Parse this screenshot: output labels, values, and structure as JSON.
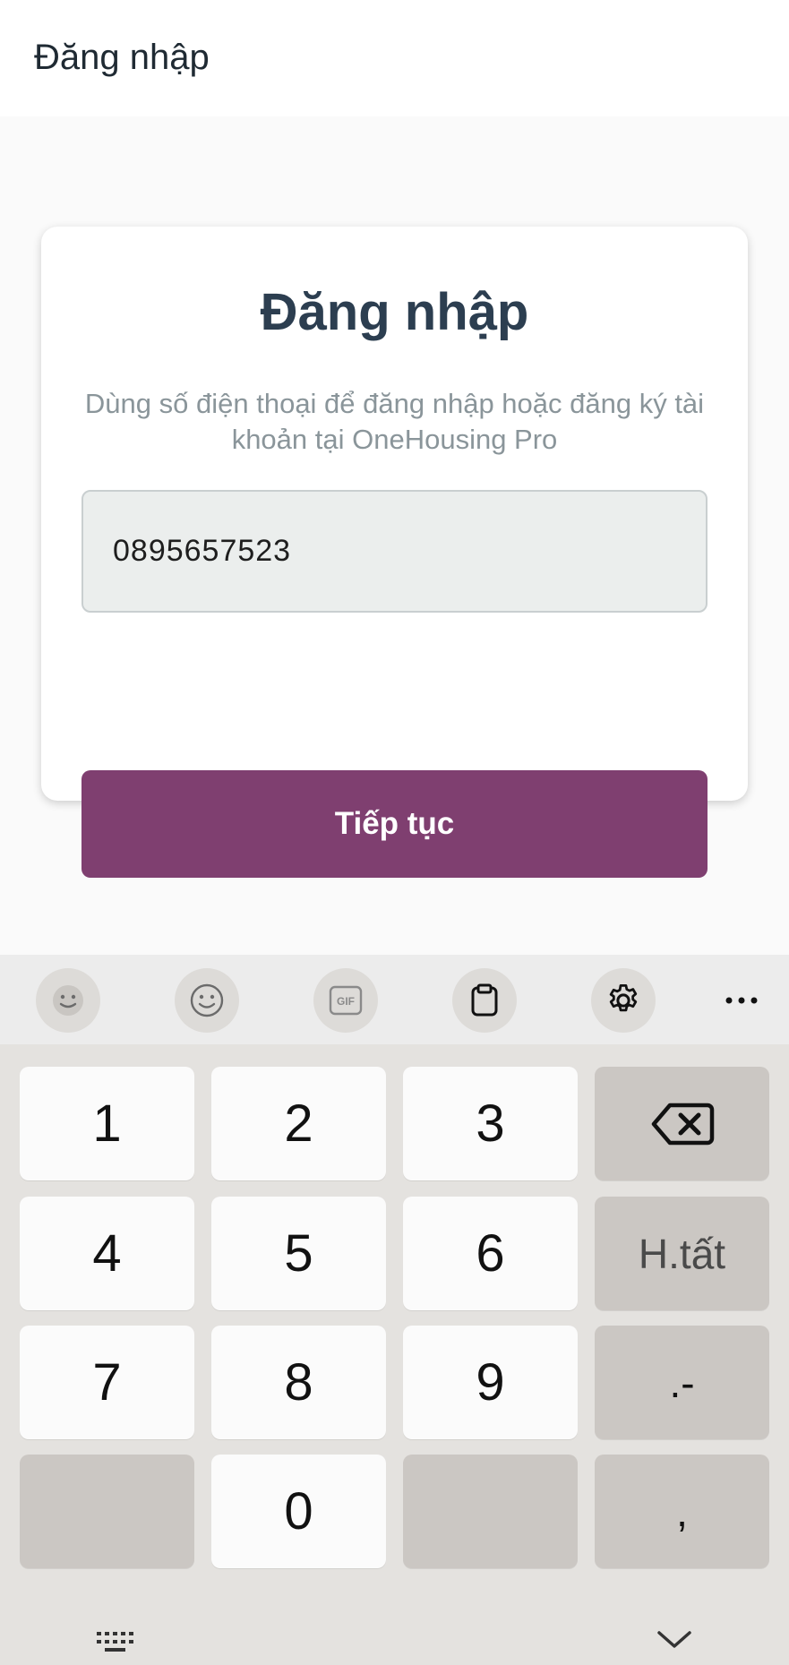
{
  "header": {
    "title": "Đăng nhập"
  },
  "card": {
    "title": "Đăng nhập",
    "subtitle": "Dùng số điện thoại để đăng nhập hoặc đăng ký tài khoản tại OneHousing Pro",
    "phone_value": "0895657523",
    "continue_label": "Tiếp tục"
  },
  "colors": {
    "accent": "#7f3f70",
    "title": "#2c3e50",
    "subtitle": "#8a959a"
  },
  "keyboard": {
    "toolbar_icons": [
      "emoji-face-icon",
      "smiley-icon",
      "gif-icon",
      "clipboard-icon",
      "settings-icon",
      "more-icon"
    ],
    "gif_label": "GIF",
    "keys": {
      "k1": "1",
      "k2": "2",
      "k3": "3",
      "k4": "4",
      "k5": "5",
      "k6": "6",
      "k7": "7",
      "k8": "8",
      "k9": "9",
      "k0": "0",
      "done": "H.tất",
      "dot_dash": ".-",
      "comma": ","
    },
    "bottom_icons": [
      "keyboard-switch-icon",
      "hide-keyboard-icon"
    ]
  }
}
